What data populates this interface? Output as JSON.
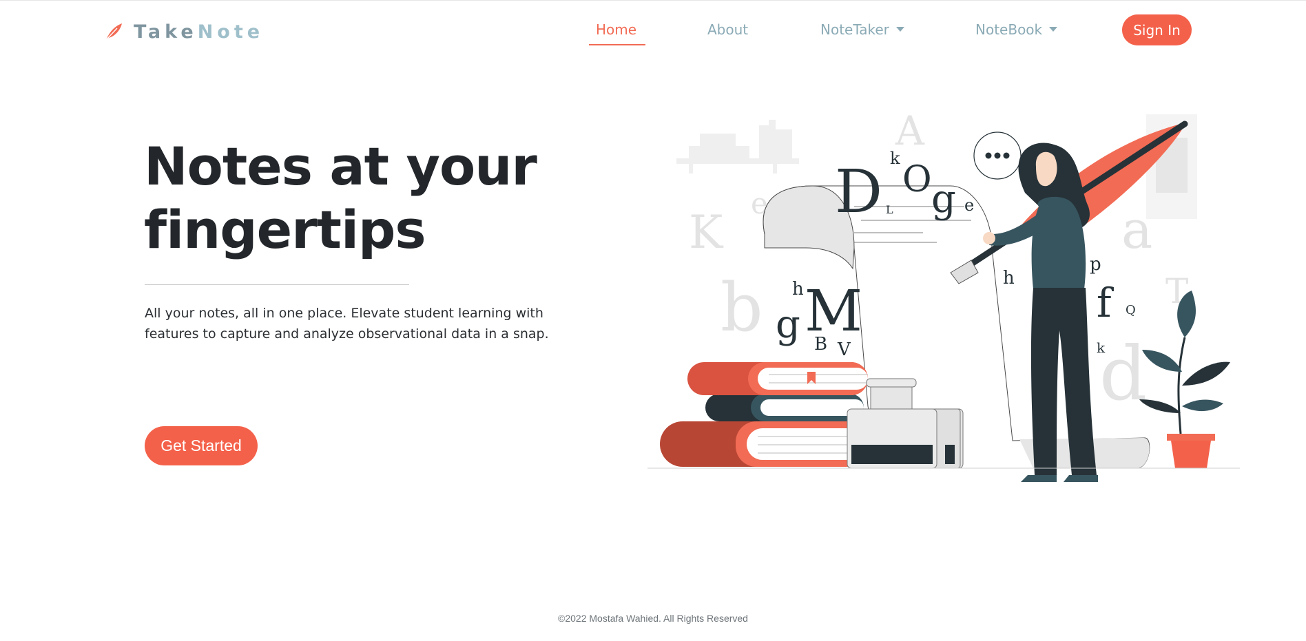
{
  "brand": {
    "take": "Take",
    "note": "Note",
    "icon": "feather-icon"
  },
  "nav": {
    "home": "Home",
    "about": "About",
    "notetaker": "NoteTaker",
    "notebook": "NoteBook",
    "active": "Home"
  },
  "signin_label": "Sign In",
  "hero": {
    "title_line1": "Notes at your",
    "title_line2": "fingertips",
    "subtitle_line1": "All your notes, all in one place. Elevate student learning with",
    "subtitle_line2": "features to capture and analyze observational data in a snap.",
    "cta_label": "Get Started"
  },
  "footer": {
    "copyright": "©2022 Mostafa Wahied. All Rights Reserved"
  },
  "colors": {
    "accent": "#f4614a",
    "nav_text": "#8aaab5",
    "dark_text": "#23272b",
    "illustration_dark": "#263238",
    "illustration_teal": "#37555f"
  }
}
